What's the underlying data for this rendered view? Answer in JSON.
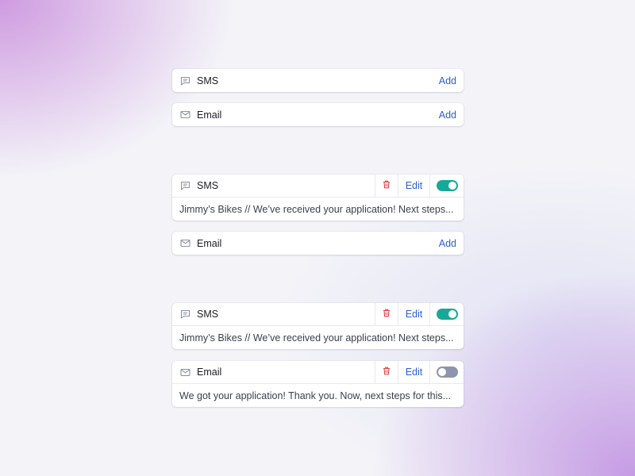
{
  "group1": {
    "sms": {
      "label": "SMS",
      "add": "Add"
    },
    "email": {
      "label": "Email",
      "add": "Add"
    }
  },
  "group2": {
    "sms": {
      "label": "SMS",
      "edit": "Edit",
      "toggle_on": true,
      "preview": "Jimmy’s Bikes // We’ve received your application! Next steps..."
    },
    "email": {
      "label": "Email",
      "add": "Add"
    }
  },
  "group3": {
    "sms": {
      "label": "SMS",
      "edit": "Edit",
      "toggle_on": true,
      "preview": "Jimmy’s Bikes // We’ve received your application! Next steps..."
    },
    "email": {
      "label": "Email",
      "edit": "Edit",
      "toggle_on": false,
      "preview": "We got your application! Thank you. Now, next steps for this..."
    }
  },
  "icons": {
    "sms": "chat-bubble-icon",
    "email": "envelope-icon",
    "delete": "trash-icon"
  },
  "colors": {
    "link": "#2c5fd1",
    "delete": "#e0464b",
    "toggle_on": "#16a99a",
    "toggle_off": "#8d94ab"
  }
}
